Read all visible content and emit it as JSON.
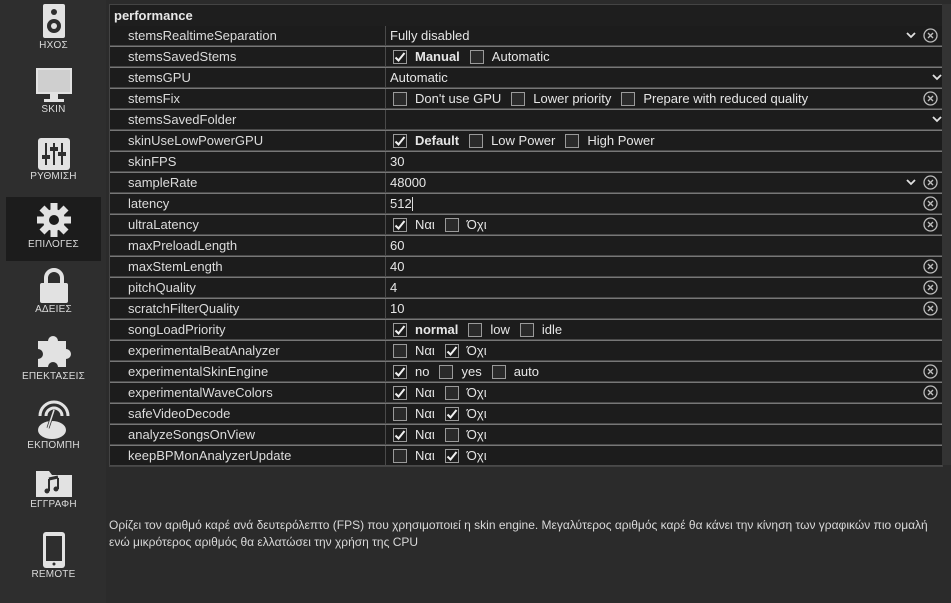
{
  "sidebar": {
    "items": [
      {
        "label": "ΗΧΟΣ"
      },
      {
        "label": "SKIN"
      },
      {
        "label": "ΡΥΘΜΙΣΗ"
      },
      {
        "label": "ΕΠΙΛΟΓΕΣ"
      },
      {
        "label": "ΑΔΕΙΕΣ"
      },
      {
        "label": "ΕΠΕΚΤΑΣΕΙΣ"
      },
      {
        "label": "ΕΚΠΟΜΠΗ"
      },
      {
        "label": "ΕΓΓΡΑΦΗ"
      },
      {
        "label": "REMOTE"
      }
    ],
    "active": "ΕΠΙΛΟΓΕΣ"
  },
  "table": {
    "header": "performance",
    "rows": [
      {
        "name": "stemsRealtimeSeparation",
        "value": "Fully disabled"
      },
      {
        "name": "stemsSavedStems",
        "options": [
          {
            "label": "Manual",
            "checked": true
          },
          {
            "label": "Automatic",
            "checked": false
          }
        ]
      },
      {
        "name": "stemsGPU",
        "value": "Automatic"
      },
      {
        "name": "stemsFix",
        "options": [
          {
            "label": "Don't use GPU",
            "checked": false
          },
          {
            "label": "Lower priority",
            "checked": false
          },
          {
            "label": "Prepare with reduced quality",
            "checked": false
          }
        ]
      },
      {
        "name": "stemsSavedFolder",
        "value": ""
      },
      {
        "name": "skinUseLowPowerGPU",
        "options": [
          {
            "label": "Default",
            "checked": true
          },
          {
            "label": "Low Power",
            "checked": false
          },
          {
            "label": "High Power",
            "checked": false
          }
        ]
      },
      {
        "name": "skinFPS",
        "value": "30"
      },
      {
        "name": "sampleRate",
        "value": "48000"
      },
      {
        "name": "latency",
        "value": "512"
      },
      {
        "name": "ultraLatency",
        "options": [
          {
            "label": "Ναι",
            "checked": true
          },
          {
            "label": "Όχι",
            "checked": false
          }
        ]
      },
      {
        "name": "maxPreloadLength",
        "value": "60"
      },
      {
        "name": "maxStemLength",
        "value": "40"
      },
      {
        "name": "pitchQuality",
        "value": "4"
      },
      {
        "name": "scratchFilterQuality",
        "value": "10"
      },
      {
        "name": "songLoadPriority",
        "options": [
          {
            "label": "normal",
            "checked": true
          },
          {
            "label": "low",
            "checked": false
          },
          {
            "label": "idle",
            "checked": false
          }
        ]
      },
      {
        "name": "experimentalBeatAnalyzer",
        "options": [
          {
            "label": "Ναι",
            "checked": false
          },
          {
            "label": "Όχι",
            "checked": true
          }
        ]
      },
      {
        "name": "experimentalSkinEngine",
        "options": [
          {
            "label": "no",
            "checked": true
          },
          {
            "label": "yes",
            "checked": false
          },
          {
            "label": "auto",
            "checked": false
          }
        ]
      },
      {
        "name": "experimentalWaveColors",
        "options": [
          {
            "label": "Ναι",
            "checked": true
          },
          {
            "label": "Όχι",
            "checked": false
          }
        ]
      },
      {
        "name": "safeVideoDecode",
        "options": [
          {
            "label": "Ναι",
            "checked": false
          },
          {
            "label": "Όχι",
            "checked": true
          }
        ]
      },
      {
        "name": "analyzeSongsOnView",
        "options": [
          {
            "label": "Ναι",
            "checked": true
          },
          {
            "label": "Όχι",
            "checked": false
          }
        ]
      },
      {
        "name": "keepBPMonAnalyzerUpdate",
        "options": [
          {
            "label": "Ναι",
            "checked": false
          },
          {
            "label": "Όχι",
            "checked": true
          }
        ]
      }
    ]
  },
  "description": "Ορίζει τον αριθμό καρέ ανά δευτερόλεπτο (FPS) που χρησιμοποιεί η skin engine. Μεγαλύτερος αριθμός καρέ θα κάνει την κίνηση των γραφικών πιο ομαλή ενώ μικρότερος αριθμός θα ελλατώσει την χρήση της CPU",
  "colors": {
    "sidebar_bg": "#2e2e2e",
    "row_bg": "#1c1c1c",
    "empty_area": "#777777",
    "active_nav": "#1c1c1c"
  },
  "icons": [
    "speaker-icon",
    "monitor-icon",
    "sliders-icon",
    "gear-icon",
    "lock-icon",
    "puzzle-icon",
    "broadcast-icon",
    "folder-music-icon",
    "phone-icon",
    "chevron-down-icon",
    "clear-icon",
    "checkmark-icon"
  ]
}
